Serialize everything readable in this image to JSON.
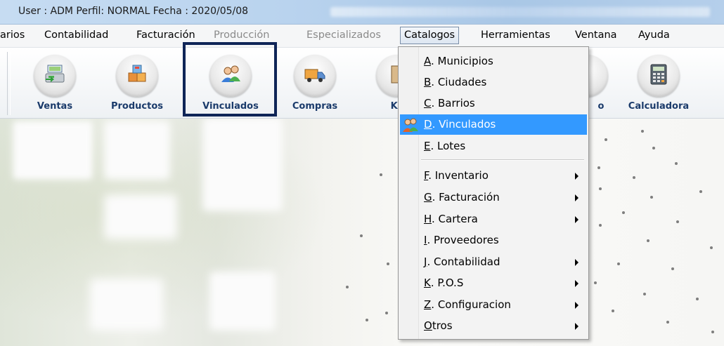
{
  "titlebar": {
    "title": "User : ADM  Perfil: NORMAL  Fecha : 2020/05/08"
  },
  "menubar": {
    "items": [
      {
        "label": "arios"
      },
      {
        "label": "Contabilidad"
      },
      {
        "label": "Facturación"
      },
      {
        "label": "Producción"
      },
      {
        "label": "Especializados"
      },
      {
        "label": "Catalogos"
      },
      {
        "label": "Herramientas"
      },
      {
        "label": "Ventana"
      },
      {
        "label": "Ayuda"
      }
    ]
  },
  "toolbar": {
    "buttons": [
      {
        "label": "Ventas",
        "icon": "cash-register-icon"
      },
      {
        "label": "Productos",
        "icon": "boxes-icon"
      },
      {
        "label": "Vinculados",
        "icon": "users-icon"
      },
      {
        "label": "Compras",
        "icon": "truck-icon"
      },
      {
        "label": "Ka",
        "icon": "kardex-icon"
      },
      {
        "label": "o",
        "icon": "generic-icon"
      },
      {
        "label": "Calculadora",
        "icon": "calculator-icon"
      }
    ]
  },
  "dropdown": {
    "items": [
      {
        "key": "A",
        "rest": ". Municipios",
        "submenu": false
      },
      {
        "key": "B",
        "rest": ". Ciudades",
        "submenu": false
      },
      {
        "key": "C",
        "rest": ". Barrios",
        "submenu": false
      },
      {
        "key": "D",
        "rest": ". Vinculados",
        "submenu": false,
        "selected": true,
        "icon": "users-icon"
      },
      {
        "key": "E",
        "rest": ". Lotes",
        "submenu": false
      },
      {
        "key": "F",
        "rest": ".  Inventario",
        "submenu": true
      },
      {
        "key": "G",
        "rest": ". Facturación",
        "submenu": true
      },
      {
        "key": "H",
        "rest": ". Cartera",
        "submenu": true
      },
      {
        "key": "I",
        "rest": ".  Proveedores",
        "submenu": false
      },
      {
        "key": "J",
        "rest": ". Contabilidad",
        "submenu": true
      },
      {
        "key": "K",
        "rest": ". P.O.S",
        "submenu": true
      },
      {
        "key": "Z",
        "rest": ". Configuracion",
        "submenu": true
      },
      {
        "key": "O",
        "rest": "tros",
        "submenu": true
      }
    ]
  },
  "colors": {
    "selection": "#3399ff",
    "highlight_box": "#0f2557",
    "toolbar_label": "#1b3b6b"
  }
}
